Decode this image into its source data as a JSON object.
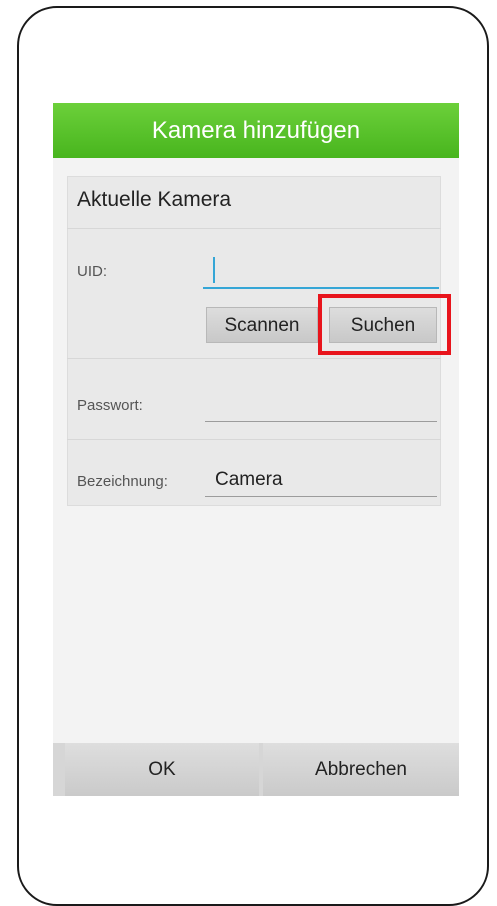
{
  "dialog": {
    "title": "Kamera hinzufügen"
  },
  "section": {
    "title": "Aktuelle Kamera"
  },
  "fields": {
    "uid_label": "UID:",
    "uid_value": "",
    "password_label": "Passwort:",
    "password_value": "",
    "name_label": "Bezeichnung:",
    "name_value": "Camera"
  },
  "buttons": {
    "scan": "Scannen",
    "search": "Suchen",
    "ok": "OK",
    "cancel": "Abbrechen"
  },
  "colors": {
    "title_bar": "#55bf28",
    "focus_accent": "#35a6d6",
    "highlight": "#e8141c"
  }
}
